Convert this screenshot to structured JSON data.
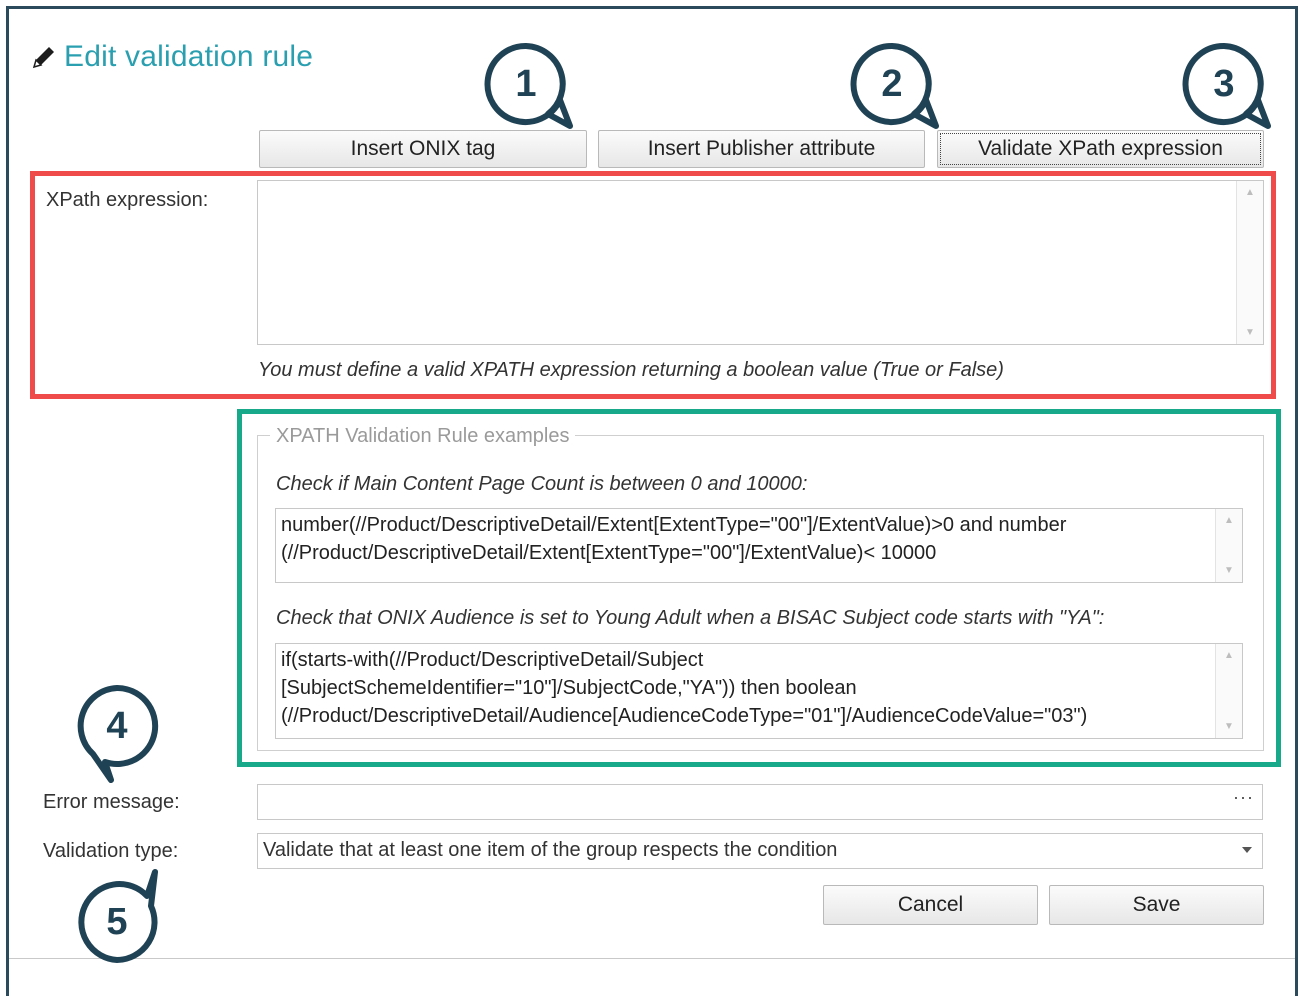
{
  "dialog": {
    "title": "Edit validation rule",
    "toolbar": {
      "insert_onix_tag": "Insert ONIX tag",
      "insert_publisher_attribute": "Insert Publisher attribute",
      "validate_xpath": "Validate XPath expression"
    },
    "xpath": {
      "label": "XPath expression:",
      "value": "",
      "hint": "You must define a valid XPATH expression returning a boolean value (True or False)"
    },
    "examples": {
      "legend": "XPATH Validation Rule examples",
      "items": [
        {
          "title": "Check if Main Content Page Count is between 0 and 10000:",
          "code": "number(//Product/DescriptiveDetail/Extent[ExtentType=\"00\"]/ExtentValue)>0 and number\n(//Product/DescriptiveDetail/Extent[ExtentType=\"00\"]/ExtentValue)< 10000"
        },
        {
          "title": "Check that ONIX Audience is set to Young Adult when a BISAC Subject code starts with \"YA\":",
          "code": "if(starts-with(//Product/DescriptiveDetail/Subject\n[SubjectSchemeIdentifier=\"10\"]/SubjectCode,\"YA\")) then boolean\n(//Product/DescriptiveDetail/Audience[AudienceCodeType=\"01\"]/AudienceCodeValue=\"03\")"
        }
      ]
    },
    "error_message": {
      "label": "Error message:",
      "value": "",
      "ellipsis": "···"
    },
    "validation_type": {
      "label": "Validation type:",
      "selected": "Validate that at least one item of the group respects the condition"
    },
    "footer": {
      "cancel": "Cancel",
      "save": "Save"
    }
  },
  "callouts": [
    "1",
    "2",
    "3",
    "4",
    "5"
  ],
  "colors": {
    "title": "#2a9fb0",
    "red_highlight": "#ef4b4b",
    "green_highlight": "#18a88a",
    "callout_stroke": "#1f4254",
    "frame": "#2b4b5c"
  },
  "icons": {
    "title_icon": "pencil-icon",
    "dropdown_icon": "chevron-down-icon"
  }
}
